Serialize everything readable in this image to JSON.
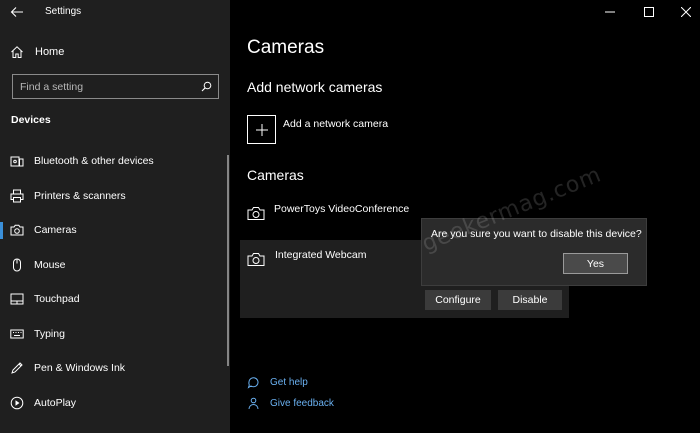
{
  "app": {
    "title": "Settings"
  },
  "sidebar": {
    "home_label": "Home",
    "search": {
      "placeholder": "Find a setting"
    },
    "section_title": "Devices",
    "items": [
      {
        "label": "Bluetooth & other devices",
        "icon": "bluetooth-devices-icon"
      },
      {
        "label": "Printers & scanners",
        "icon": "printer-icon"
      },
      {
        "label": "Cameras",
        "icon": "camera-icon",
        "active": true
      },
      {
        "label": "Mouse",
        "icon": "mouse-icon"
      },
      {
        "label": "Touchpad",
        "icon": "touchpad-icon"
      },
      {
        "label": "Typing",
        "icon": "keyboard-icon"
      },
      {
        "label": "Pen & Windows Ink",
        "icon": "pen-icon"
      },
      {
        "label": "AutoPlay",
        "icon": "autoplay-icon"
      }
    ]
  },
  "main": {
    "title": "Cameras",
    "add_section_title": "Add network cameras",
    "add_label": "Add a network camera",
    "cameras_section_title": "Cameras",
    "cameras": [
      {
        "name": "PowerToys VideoConference"
      },
      {
        "name": "Integrated Webcam"
      }
    ],
    "buttons": {
      "configure": "Configure",
      "disable": "Disable"
    },
    "dialog": {
      "message": "Are you sure you want to disable this device?",
      "yes": "Yes"
    },
    "watermark": "geekermag.com",
    "help_links": {
      "get_help": "Get help",
      "give_feedback": "Give feedback"
    }
  },
  "colors": {
    "accent": "#3a8fd9",
    "link": "#6ab0f0",
    "sidebar_bg": "#1f1f1f",
    "main_bg": "#000000"
  }
}
